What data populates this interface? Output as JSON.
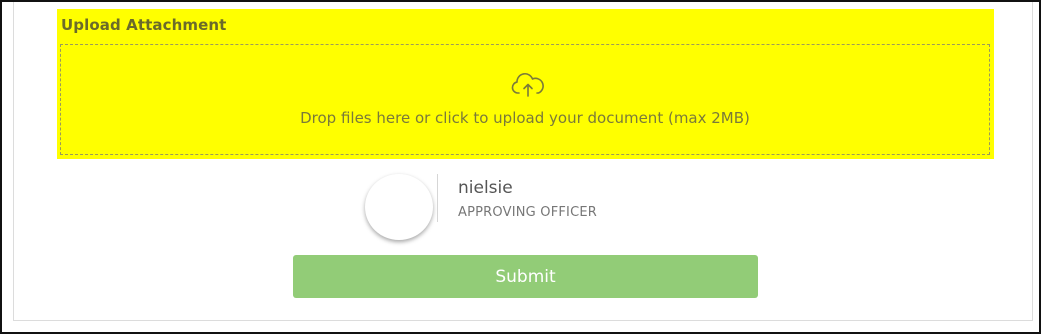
{
  "upload": {
    "title": "Upload Attachment",
    "drop_text": "Drop files here or click to upload your document (max 2MB)",
    "icon": "cloud-upload-icon",
    "highlight_color": "#ffff00"
  },
  "user": {
    "name": "nielsie",
    "role": "APPROVING OFFICER"
  },
  "actions": {
    "submit_label": "Submit",
    "submit_color": "#92cc77"
  }
}
